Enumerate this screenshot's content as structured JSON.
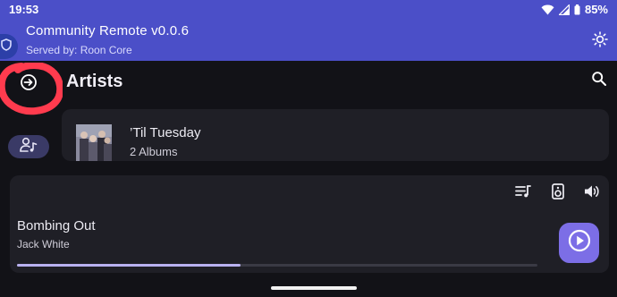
{
  "status_bar": {
    "time": "19:53",
    "battery_percent": "85%"
  },
  "app": {
    "title": "Community Remote v0.0.6",
    "subtitle": "Served by: Roon Core"
  },
  "page": {
    "title": "Artists"
  },
  "artists": [
    {
      "name": "’Til Tuesday",
      "albums": "2 Albums"
    }
  ],
  "now_playing": {
    "title": "Bombing Out",
    "artist": "Jack White",
    "progress": 0.43
  },
  "colors": {
    "accent": "#4b4fc8",
    "play_button": "#7c6ee6",
    "progress": "#b9b1f0",
    "annotation": "#ff3b4e"
  },
  "icons": {
    "statusbar": [
      "wifi-icon",
      "signal-icon",
      "battery-icon"
    ],
    "header": [
      "shield-icon",
      "brightness-icon"
    ],
    "nav": [
      "arrow-right-circle-icon",
      "person-music-icon",
      "search-icon"
    ],
    "player": [
      "queue-icon",
      "speaker-icon",
      "volume-icon",
      "play-circle-icon"
    ]
  }
}
